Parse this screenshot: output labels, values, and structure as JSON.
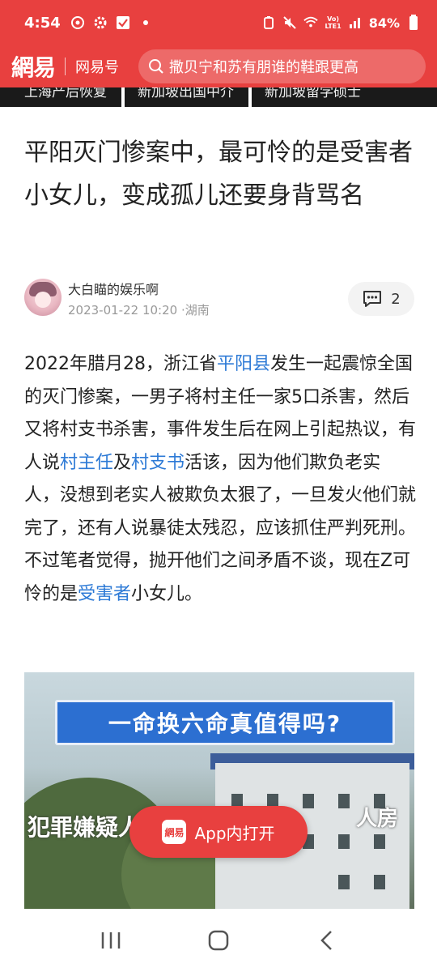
{
  "status": {
    "time": "4:54",
    "battery": "84%",
    "volte_top": "Vo)",
    "volte_bottom": "LTE1"
  },
  "header": {
    "logo": "網易",
    "app_name": "网易号",
    "search_text": "撒贝宁和苏有朋谁的鞋跟更高"
  },
  "hot_strip": [
    "上海产后恢复",
    "新加坡出国中介",
    "新加坡留学硕士"
  ],
  "article": {
    "title": "平阳灭门惨案中，最可怜的是受害者小女儿，变成孤儿还要身背骂名",
    "author": "大白瞄的娱乐啊",
    "datetime": "2023-01-22 10:20",
    "location": "·湖南",
    "comment_count": "2",
    "body": {
      "p1": "2022年腊月28，浙江省",
      "link1": "平阳县",
      "p2": "发生一起震惊全国的灭门惨案，一男子将村主任一家5口杀害，然后又将村支书杀害，事件发生后在网上引起热议，有人说",
      "link2": "村主任",
      "p3": "及",
      "link3": "村支书",
      "p4": "活该，因为他们欺负老实人，没想到老实人被欺负太狠了，一旦发火他们就完了，还有人说暴徒太残忍，应该抓住严判死刑。不过笔者觉得，抛开他们之间矛盾不谈，现在Z可怜的是",
      "link4": "受害者",
      "p5": "小女儿。"
    },
    "image": {
      "banner": "一命换六命真值得吗?",
      "caption_left": "犯罪嫌疑人家",
      "caption_right": "人房"
    }
  },
  "open_app": {
    "logo": "網易",
    "label": "App内打开"
  },
  "colors": {
    "brand_red": "#e8403f",
    "link_blue": "#2d7ad6"
  }
}
